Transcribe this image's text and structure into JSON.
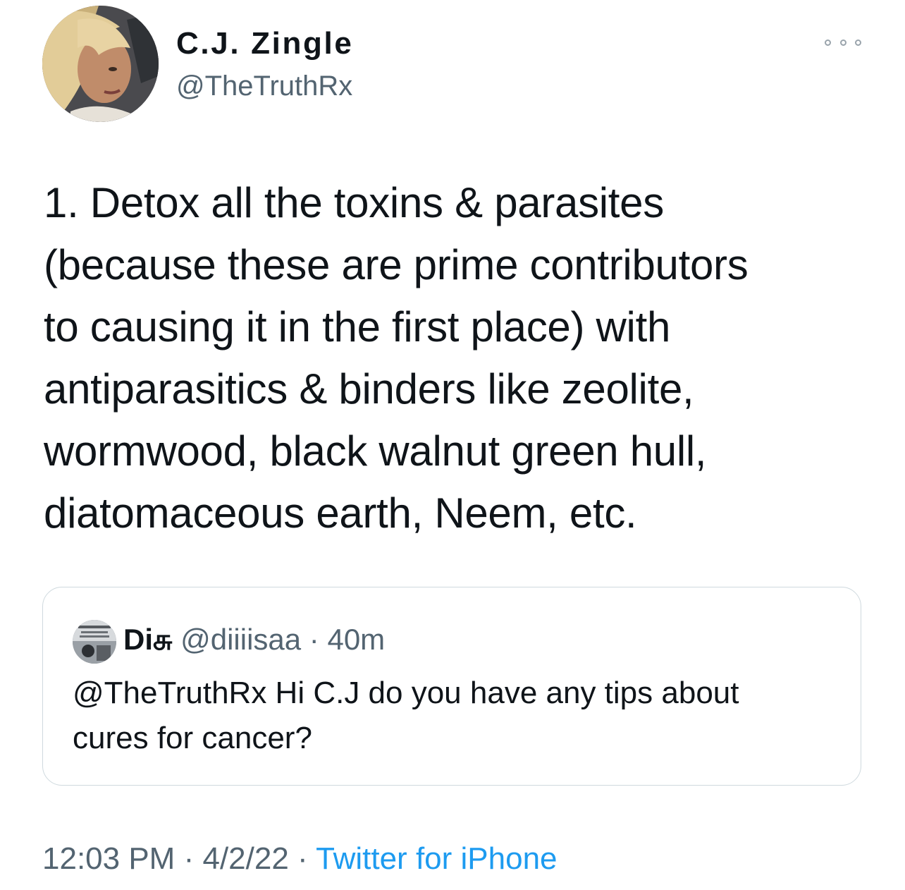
{
  "author": {
    "display_name": "C.J. Zingle",
    "handle": "@TheTruthRx"
  },
  "more_icon": "ellipsis-icon",
  "tweet": {
    "text": "1. Detox all the toxins & parasites\n(because these are prime contributors\nto causing it in the first place) with\nantiparasitics & binders like zeolite,\nwormwood, black walnut green hull,\ndiatomaceous earth, Neem, etc."
  },
  "quoted_tweet": {
    "display_name": "Diசு",
    "handle": "@diiiisaa",
    "separator": "·",
    "time": "40m",
    "text": "@TheTruthRx Hi C.J do you have any tips about\ncures for cancer?"
  },
  "footer": {
    "time": "12:03 PM",
    "separator_1": "·",
    "date": "4/2/22",
    "separator_2": "·",
    "source": "Twitter for iPhone"
  },
  "colors": {
    "text": "#0f1419",
    "secondary": "#536471",
    "link": "#1d9bf0",
    "border": "#cfd9de"
  }
}
